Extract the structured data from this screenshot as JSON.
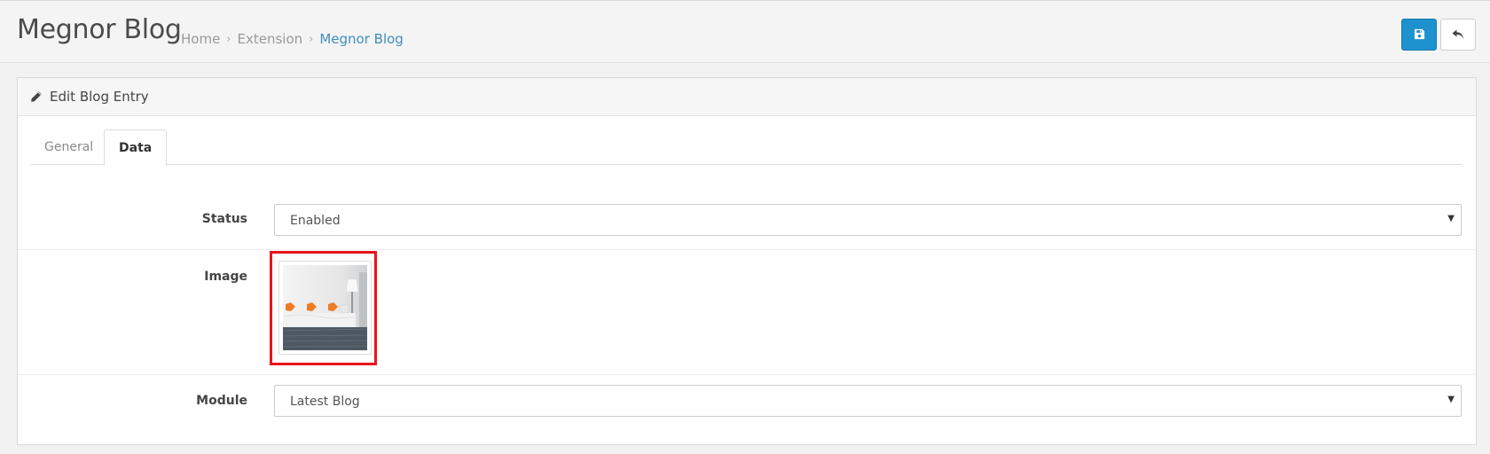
{
  "header": {
    "title": "Megnor Blog",
    "breadcrumbs": [
      {
        "label": "Home"
      },
      {
        "label": "Extension"
      },
      {
        "label": "Megnor Blog"
      }
    ],
    "separator": "›"
  },
  "actions": {
    "save_icon": "save-icon",
    "back_icon": "reply-icon"
  },
  "panel": {
    "title": "Edit Blog Entry",
    "icon": "pencil-icon"
  },
  "tabs": [
    {
      "label": "General",
      "active": false
    },
    {
      "label": "Data",
      "active": true
    }
  ],
  "form": {
    "status": {
      "label": "Status",
      "value": "Enabled"
    },
    "image": {
      "label": "Image"
    },
    "module": {
      "label": "Module",
      "value": "Latest Blog"
    }
  },
  "colors": {
    "primary_button": "#1e91cf",
    "link": "#3f8ebd",
    "highlight": "#e8141b"
  }
}
